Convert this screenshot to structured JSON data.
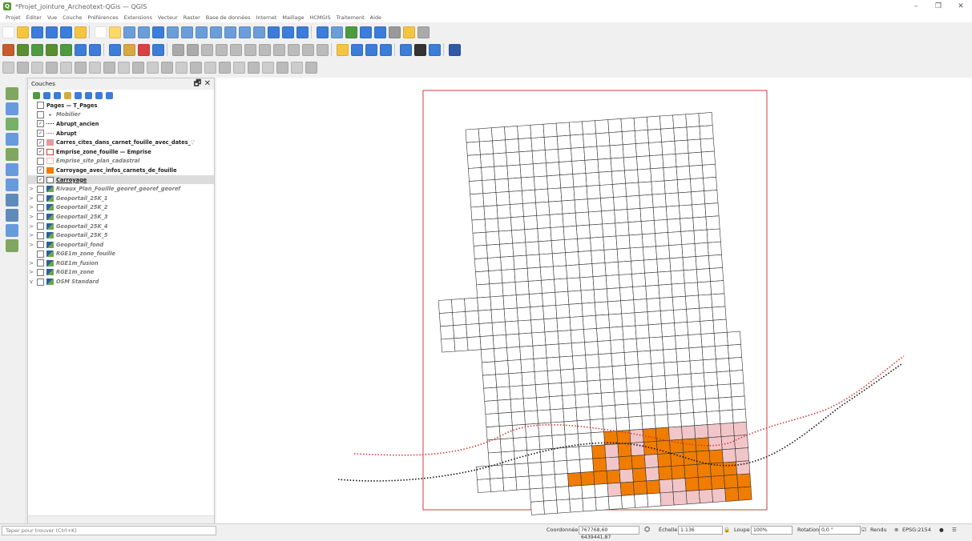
{
  "window": {
    "title": "*Projet_jointure_Archeotext-QGis — QGIS",
    "app_icon": "qgis-logo"
  },
  "menu": [
    "Projet",
    "Éditer",
    "Vue",
    "Couche",
    "Préférences",
    "Extensions",
    "Vecteur",
    "Raster",
    "Base de données",
    "Internet",
    "Maillage",
    "HCMGIS",
    "Traitement",
    "Aide"
  ],
  "panel": {
    "title": "Couches",
    "layers": [
      {
        "label": "Pages — T_Pages",
        "checked": false,
        "style": "b",
        "symbol": "none",
        "expand": ""
      },
      {
        "label": "Mobilier",
        "checked": false,
        "style": "i",
        "symbol": "dot",
        "expand": ""
      },
      {
        "label": "Abrupt_ancien",
        "checked": true,
        "style": "b",
        "symbol": "dash-black",
        "expand": ""
      },
      {
        "label": "Abrupt",
        "checked": true,
        "style": "b",
        "symbol": "dash-red",
        "expand": ""
      },
      {
        "label": "Carres_cites_dans_carnet_fouille_avec_dates_",
        "checked": true,
        "style": "b",
        "symbol": "fill-pink",
        "expand": ""
      },
      {
        "label": "Emprise_zone_fouille — Emprise",
        "checked": true,
        "style": "b",
        "symbol": "outline-red",
        "expand": ""
      },
      {
        "label": "Emprise_site_plan_cadastral",
        "checked": false,
        "style": "i",
        "symbol": "outline-pink",
        "expand": ""
      },
      {
        "label": "Carroyage_avec_infos_carnets_de_fouille",
        "checked": true,
        "style": "b",
        "symbol": "fill-orange",
        "expand": ""
      },
      {
        "label": "Carroyage",
        "checked": true,
        "style": "b",
        "symbol": "outline-grey",
        "expand": "",
        "selected": true
      },
      {
        "label": "Rivaux_Plan_Fouille_georef_georef_georef",
        "checked": false,
        "style": "i",
        "symbol": "raster",
        "expand": ">"
      },
      {
        "label": "Geoportail_25K_1",
        "checked": false,
        "style": "i",
        "symbol": "raster",
        "expand": ">"
      },
      {
        "label": "Geoportail_25K_2",
        "checked": false,
        "style": "i",
        "symbol": "raster",
        "expand": ">"
      },
      {
        "label": "Geoportail_25K_3",
        "checked": false,
        "style": "i",
        "symbol": "raster",
        "expand": ">"
      },
      {
        "label": "Geoportail_25K_4",
        "checked": false,
        "style": "i",
        "symbol": "raster",
        "expand": ">"
      },
      {
        "label": "Geoportail_25K_5",
        "checked": false,
        "style": "i",
        "symbol": "raster",
        "expand": ">"
      },
      {
        "label": "Geoportail_fond",
        "checked": false,
        "style": "i",
        "symbol": "raster",
        "expand": ">"
      },
      {
        "label": "RGE1m_zone_fouille",
        "checked": false,
        "style": "i",
        "symbol": "raster",
        "expand": ""
      },
      {
        "label": "RGE1m_fusion",
        "checked": false,
        "style": "i",
        "symbol": "raster",
        "expand": ">"
      },
      {
        "label": "RGE1m_zone",
        "checked": false,
        "style": "i",
        "symbol": "raster",
        "expand": ">"
      },
      {
        "label": "OSM Standard",
        "checked": false,
        "style": "i",
        "symbol": "raster",
        "expand": "v"
      }
    ]
  },
  "status": {
    "search_placeholder": "Taper pour trouver (Ctrl+K)",
    "coord_label": "Coordonnée",
    "coord_value": "767768,60 6439441,87",
    "scale_label": "Échelle",
    "scale_value": "1:136",
    "magnifier_label": "Loupe",
    "magnifier_value": "100%",
    "rotation_label": "Rotation",
    "rotation_value": "0,0 °",
    "render_label": "Rendu",
    "crs_label": "EPSG:2154"
  },
  "colors": {
    "orange": "#f07d00",
    "pink": "#f2c6c8",
    "red": "#d23c3c",
    "qgis_green": "#589632"
  }
}
